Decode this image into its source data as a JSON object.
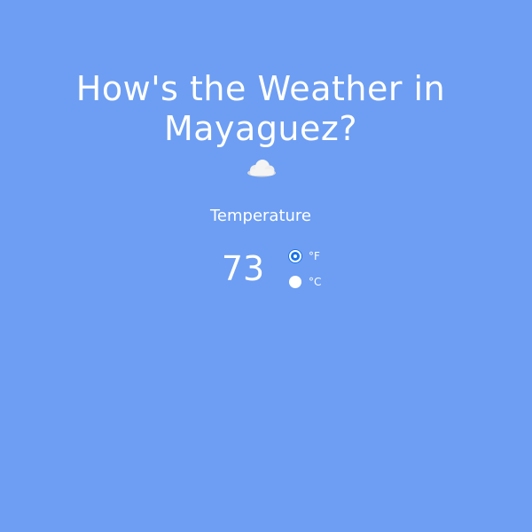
{
  "header": {
    "title_line1": "How's the Weather in",
    "title_line2": "Mayaguez?",
    "condition_icon": "cloud-icon"
  },
  "temperature": {
    "label": "Temperature",
    "value": "73",
    "units": [
      {
        "label": "°F",
        "selected": true
      },
      {
        "label": "°C",
        "selected": false
      }
    ]
  },
  "colors": {
    "background": "#6d9ef3",
    "text": "#ffffff",
    "radio_selected": "#1a73e8"
  }
}
